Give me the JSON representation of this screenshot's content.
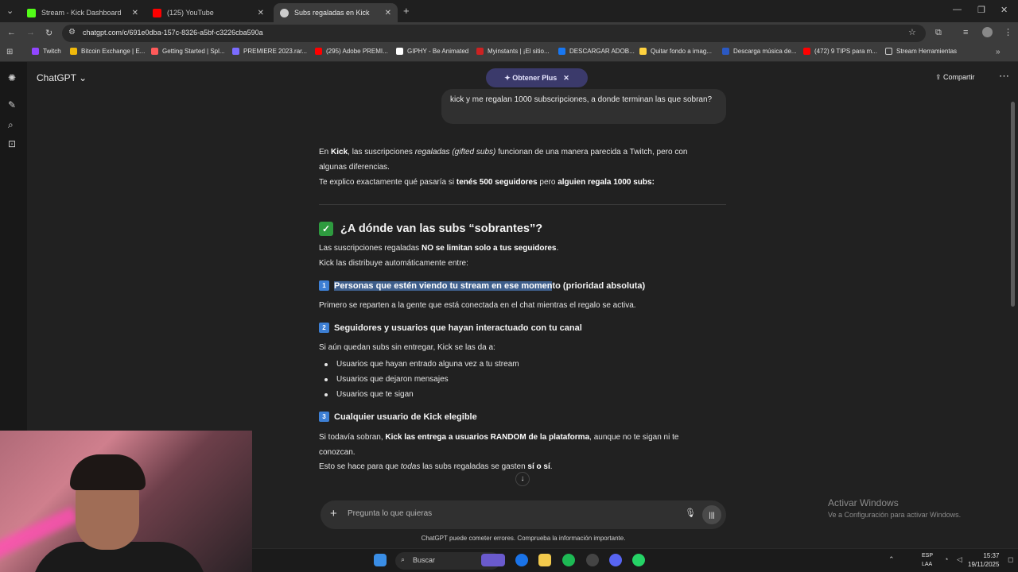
{
  "browser": {
    "tabs": [
      {
        "title": "Stream - Kick Dashboard",
        "color": "#53fc18"
      },
      {
        "title": "(125) YouTube",
        "color": "#ff0000"
      },
      {
        "title": "Subs regaladas en Kick",
        "color": "#cccccc"
      }
    ],
    "url": "chatgpt.com/c/691e0dba-157c-8326-a5bf-c3226cba590a",
    "bookmarks": [
      "Twitch",
      "Bitcoin Exchange | E...",
      "Getting Started | Spl...",
      "PREMIERE 2023.rar...",
      "(295) Adobe PREMI...",
      "GIPHY - Be Animated",
      "Myinstants | ¡El sitio...",
      "DESCARGAR ADOB...",
      "Quitar fondo a imag...",
      "Descarga música de...",
      "(472) 9 TIPS para m...",
      "Stream Herramientas"
    ]
  },
  "app": {
    "brand": "ChatGPT",
    "plus": "Obtener Plus",
    "share": "Compartir",
    "user_message": "kick y me regalan 1000 subscripciones, a donde terminan las que sobran?",
    "composer_placeholder": "Pregunta lo que quieras",
    "disclaimer": "ChatGPT puede cometer errores. Comprueba la información importante."
  },
  "answer": {
    "intro_1a": "En ",
    "intro_1b": "Kick",
    "intro_1c": ", las suscripciones ",
    "intro_1d": "regaladas (gifted subs)",
    "intro_1e": " funcionan de una manera parecida a Twitch, pero con algunas diferencias.",
    "intro_2a": "Te explico exactamente qué pasaría si ",
    "intro_2b": "tenés 500 seguidores",
    "intro_2c": " pero ",
    "intro_2d": "alguien regala 1000 subs:",
    "heading": "¿A dónde van las subs “sobrantes”?",
    "p1a": "Las suscripciones regaladas ",
    "p1b": "NO se limitan solo a tus seguidores",
    "p1c": ".",
    "p2": "Kick las distribuye automáticamente entre:",
    "s1_num": "1",
    "s1_hl": "Personas que estén viendo tu stream en ese momen",
    "s1_rest": "to (prioridad absoluta)",
    "s1_text": "Primero se reparten a la gente que está conectada en el chat mientras el regalo se activa.",
    "s2_num": "2",
    "s2_title": "Seguidores y usuarios que hayan interactuado con tu canal",
    "s2_text": "Si aún quedan subs sin entregar, Kick se las da a:",
    "s2_items": [
      "Usuarios que hayan entrado alguna vez a tu stream",
      "Usuarios que dejaron mensajes",
      "Usuarios que te sigan"
    ],
    "s3_num": "3",
    "s3_title": "Cualquier usuario de Kick elegible",
    "s3_a": "Si todavía sobran, ",
    "s3_b": "Kick las entrega a usuarios RANDOM de la plataforma",
    "s3_c": ", aunque no te sigan ni te conozcan.",
    "s3_d": "Esto se hace para que ",
    "s3_e": "todas",
    "s3_f": " las subs regaladas se gasten ",
    "s3_g": "sí o sí",
    "s3_h": "."
  },
  "windows": {
    "activate_title": "Activar Windows",
    "activate_sub": "Ve a Configuración para activar Windows.",
    "search": "Buscar",
    "lang1": "ESP",
    "lang2": "LAA",
    "time": "15:37",
    "date": "19/11/2025"
  }
}
